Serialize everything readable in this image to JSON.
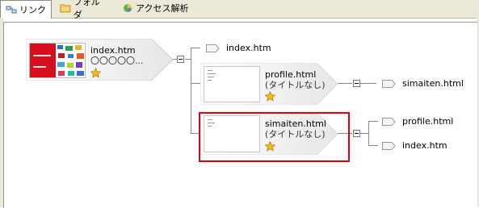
{
  "tabs": [
    {
      "label": "リンク",
      "icon": "link-icon",
      "active": true
    },
    {
      "label": "フォルダ",
      "icon": "folder-icon",
      "active": false
    },
    {
      "label": "アクセス解析",
      "icon": "access-analysis-icon",
      "active": false
    }
  ],
  "tree": {
    "root": {
      "filename": "index.htm",
      "title": "〇〇〇〇〇...",
      "icon": "star-icon"
    },
    "root_link": {
      "filename": "index.htm"
    },
    "profile": {
      "filename": "profile.html",
      "title": "(タイトルなし)",
      "icon": "star-icon"
    },
    "profile_link": {
      "filename": "simaiten.html"
    },
    "simaiten": {
      "filename": "simaiten.html",
      "title": "(タイトルなし)",
      "icon": "star-icon"
    },
    "simaiten_links": [
      {
        "filename": "profile.html"
      },
      {
        "filename": "index.htm"
      }
    ]
  },
  "colors": {
    "highlight": "#e0000f",
    "tab_background": "#ece9d8"
  }
}
